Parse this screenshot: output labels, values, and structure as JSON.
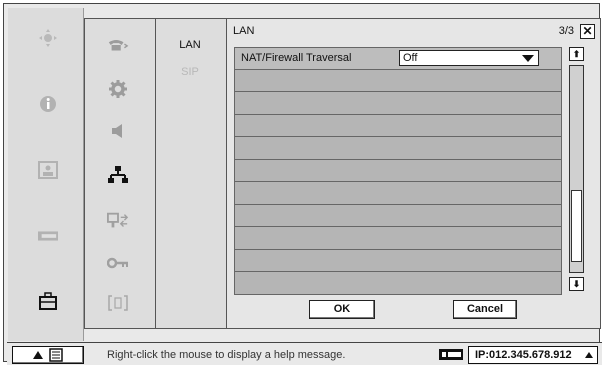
{
  "left_nav": {
    "icons": [
      "dpad-icon",
      "info-icon",
      "picture-icon",
      "network-card-icon",
      "toolbox-icon"
    ]
  },
  "sub_nav": {
    "icons": [
      "phone-icon",
      "gear-icon",
      "speaker-icon",
      "network-icon",
      "monitor-arrows-icon",
      "key-icon",
      "bracket-icon"
    ]
  },
  "categories": [
    {
      "label": "LAN"
    },
    {
      "label": "SIP"
    }
  ],
  "panel": {
    "title": "LAN",
    "page": "3/3",
    "close_label": "✕",
    "rows": [
      {
        "label": "NAT/Firewall Traversal",
        "value": "Off"
      }
    ],
    "ok_label": "OK",
    "cancel_label": "Cancel"
  },
  "status_bar": {
    "help_text": "Right-click the mouse to display a help message.",
    "ip_text": "IP:012.345.678.912"
  }
}
